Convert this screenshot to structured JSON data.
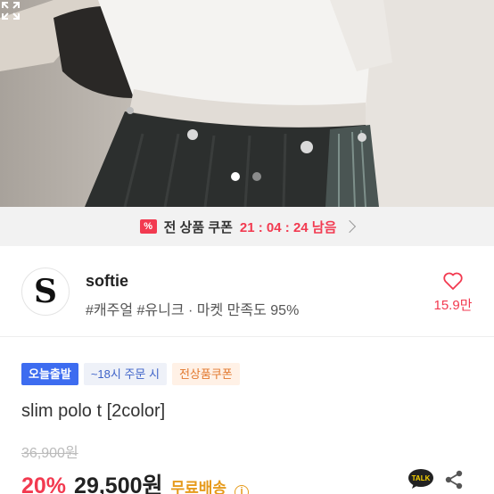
{
  "hero": {
    "image_icon": "product-photo",
    "slides_total": 2,
    "active_slide": 1,
    "expand_icon": "expand-icon"
  },
  "coupon": {
    "icon": "coupon-icon",
    "icon_glyph": "%",
    "label": "전 상품 쿠폰",
    "timer": "21 : 04 : 24 남음"
  },
  "shop": {
    "name": "softie",
    "logo_letter": "S",
    "tags": "#캐주얼 #유니크 · 마켓 만족도 95%",
    "likes": "15.9만"
  },
  "product": {
    "badges": [
      "오늘출발",
      "~18시 주문 시",
      "전상품쿠폰"
    ],
    "title": "slim polo t [2color]",
    "original_price": "36,900원",
    "discount": "20%",
    "price": "29,500원",
    "shipping": "무료배송",
    "talk_label": "TALK"
  },
  "colors": {
    "accent": "#f23a50",
    "badge_blue": "#3d6cf0",
    "shipping": "#e69a1b"
  }
}
